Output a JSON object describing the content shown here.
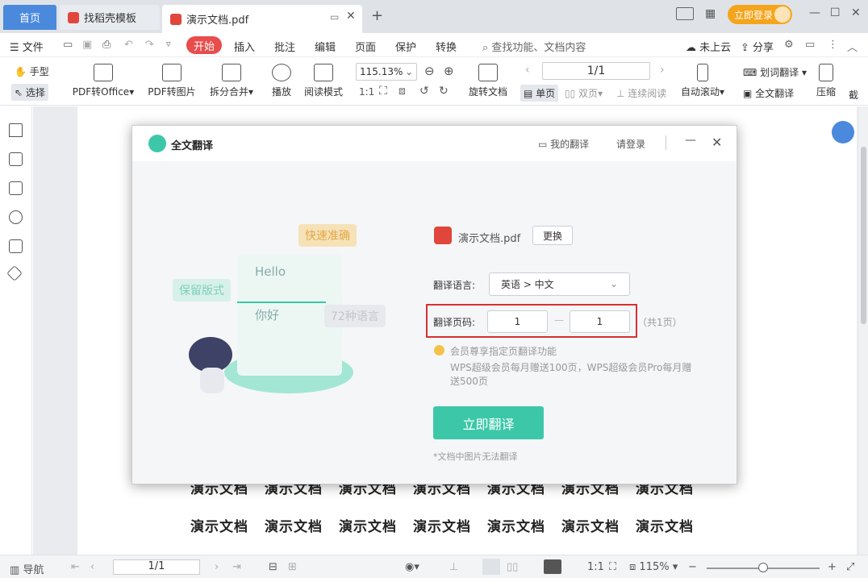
{
  "tabs": {
    "home": "首页",
    "template": "找稻壳模板",
    "doc": "演示文档.pdf",
    "login": "立即登录"
  },
  "menu": {
    "file": "文件",
    "start": "开始",
    "insert": "插入",
    "annotate": "批注",
    "edit": "编辑",
    "page": "页面",
    "protect": "保护",
    "convert": "转换",
    "search": "查找功能、文档内容",
    "cloud": "未上云",
    "share": "分享"
  },
  "toolbar": {
    "hand": "手型",
    "select": "选择",
    "pdf_office": "PDF转Office",
    "pdf_image": "PDF转图片",
    "split_merge": "拆分合并",
    "play": "播放",
    "read_mode": "阅读模式",
    "zoom": "115.13%",
    "page_num": "1/1",
    "rotate": "旋转文档",
    "single": "单页",
    "double": "双页",
    "continuous": "连续阅读",
    "auto_scroll": "自动滚动",
    "word_translate": "划词翻译",
    "full_translate": "全文翻译",
    "compress": "压缩",
    "cut": "截"
  },
  "dialog": {
    "title": "全文翻译",
    "my_translate": "我的翻译",
    "login": "请登录",
    "file_name": "演示文档.pdf",
    "change": "更换",
    "lang_label": "翻译语言:",
    "lang_value": "英语 > 中文",
    "page_label": "翻译页码:",
    "page_from": "1",
    "page_to": "1",
    "page_total": "（共1页）",
    "vip_title": "会员尊享指定页翻译功能",
    "vip_desc": "WPS超级会员每月赠送100页，WPS超级会员Pro每月赠送500页",
    "translate_btn": "立即翻译",
    "note": "*文档中图片无法翻译",
    "illus_fast": "快速准确",
    "illus_format": "保留版式",
    "illus_langs": "72种语言",
    "illus_hello": "Hello",
    "illus_nihao": "你好"
  },
  "doc_text": "演示文档",
  "status": {
    "nav": "导航",
    "page": "1/1",
    "zoom": "115%"
  },
  "colors": {
    "accent_blue": "#4a89dc",
    "accent_green": "#3cc8a8",
    "red": "#e0463b",
    "orange": "#f4a51c"
  }
}
